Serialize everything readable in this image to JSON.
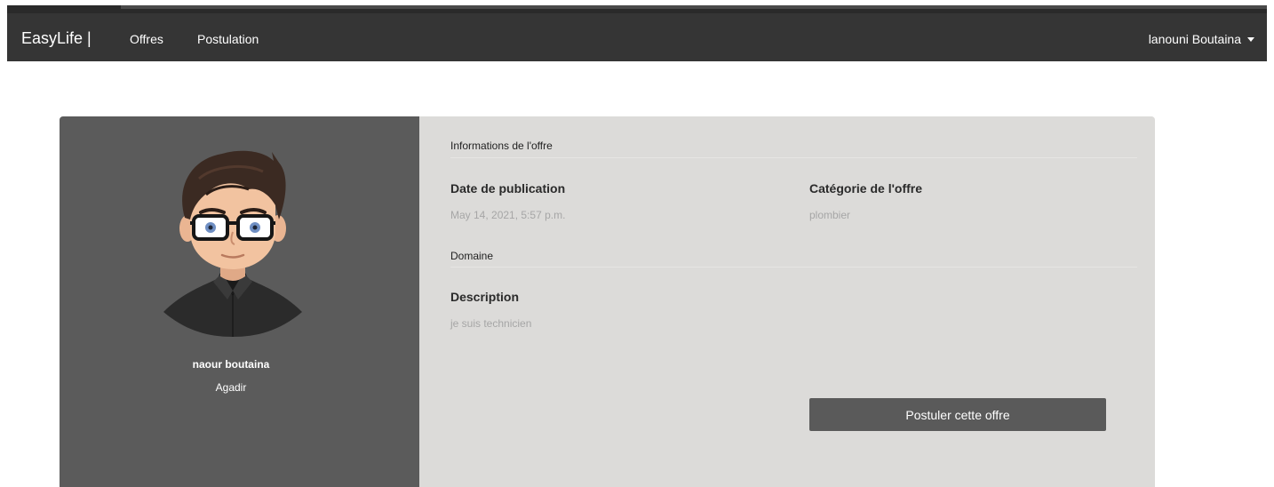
{
  "navbar": {
    "brand": "EasyLife |",
    "links": [
      {
        "label": "Offres"
      },
      {
        "label": "Postulation"
      }
    ],
    "user_menu_label": "lanouni Boutaina"
  },
  "profile": {
    "name": "naour boutaina",
    "city": "Agadir",
    "avatar_icon": "avatar-man-glasses-icon"
  },
  "offer": {
    "section_title": "Informations de l'offre",
    "date_label": "Date de publication",
    "date_value": "May 14, 2021, 5:57 p.m.",
    "category_label": "Catégorie de l'offre",
    "category_value": "plombier",
    "domain_title": "Domaine",
    "description_label": "Description",
    "description_value": "je suis technicien",
    "apply_label": "Postuler cette offre"
  },
  "colors": {
    "navbar": "#353535",
    "profile_panel": "#5b5b5b",
    "card": "#dcdbd9",
    "button": "#5a5a5a"
  }
}
